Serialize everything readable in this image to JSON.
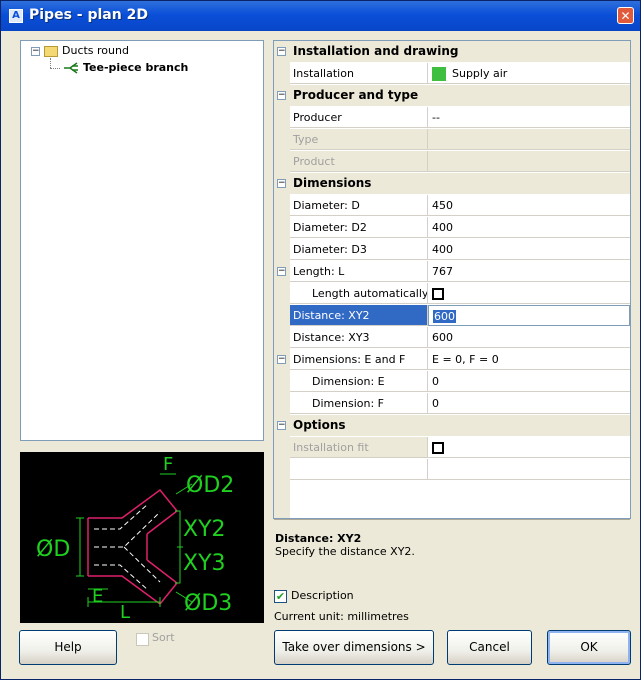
{
  "window": {
    "title": "Pipes - plan 2D",
    "close_glyph": "✕"
  },
  "tree": {
    "root_label": "Ducts round",
    "child_label": "Tee-piece branch"
  },
  "properties": {
    "cat_installation": "Installation and drawing",
    "installation_label": "Installation",
    "installation_value": "Supply air",
    "installation_color": "#3fbf3f",
    "cat_producer": "Producer and type",
    "producer_label": "Producer",
    "producer_value": "--",
    "type_label": "Type",
    "product_label": "Product",
    "cat_dimensions": "Dimensions",
    "d_label": "Diameter: D",
    "d_value": "450",
    "d2_label": "Diameter: D2",
    "d2_value": "400",
    "d3_label": "Diameter: D3",
    "d3_value": "400",
    "l_label": "Length: L",
    "l_value": "767",
    "lauto_label": "Length automatically",
    "xy2_label": "Distance: XY2",
    "xy2_value": "600",
    "xy3_label": "Distance: XY3",
    "xy3_value": "600",
    "ef_label": "Dimensions: E and F",
    "ef_value": "E = 0,  F = 0",
    "e_label": "Dimension: E",
    "e_value": "0",
    "f_label": "Dimension: F",
    "f_value": "0",
    "cat_options": "Options",
    "fit_label": "Installation fit"
  },
  "help": {
    "title": "Distance: XY2",
    "description": "Specify the distance XY2."
  },
  "description_label": "Description",
  "current_unit": "Current unit: millimetres",
  "preview": {
    "label_d": "ØD",
    "label_d2": "ØD2",
    "label_d3": "ØD3",
    "label_xy2": "XY2",
    "label_xy3": "XY3",
    "label_e": "E",
    "label_f": "F",
    "label_l": "L"
  },
  "buttons": {
    "help": "Help",
    "sort": "Sort",
    "take_over": "Take over dimensions  >",
    "cancel": "Cancel",
    "ok": "OK"
  }
}
